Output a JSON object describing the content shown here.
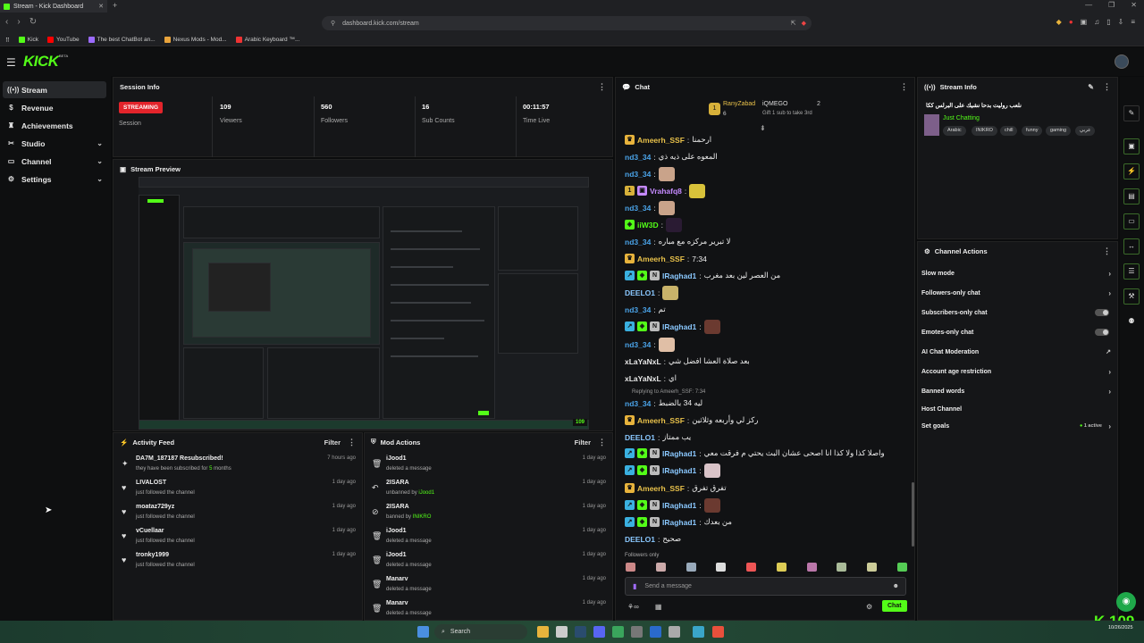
{
  "browser": {
    "tab_title": "Stream - Kick Dashboard",
    "url": "dashboard.kick.com/stream",
    "bookmarks": [
      {
        "label": "Kick",
        "color": "#53fc18"
      },
      {
        "label": "YouTube",
        "color": "#ff0000"
      },
      {
        "label": "The best ChatBot an...",
        "color": "#9c6bff"
      },
      {
        "label": "Nexus Mods - Mod...",
        "color": "#e8a33c"
      },
      {
        "label": "Arabic Keyboard ™...",
        "color": "#e33"
      }
    ]
  },
  "app": {
    "logo": "KICK",
    "logo_badge": "BETA"
  },
  "sidebar": {
    "items": [
      {
        "label": "Stream",
        "icon": "broadcast-icon",
        "active": true
      },
      {
        "label": "Revenue",
        "icon": "dollar-icon"
      },
      {
        "label": "Achievements",
        "icon": "trophy-icon"
      },
      {
        "label": "Studio",
        "icon": "studio-icon",
        "chevron": true
      },
      {
        "label": "Channel",
        "icon": "channel-icon",
        "chevron": true
      },
      {
        "label": "Settings",
        "icon": "gear-icon",
        "chevron": true
      }
    ]
  },
  "session_info": {
    "title": "Session Info",
    "badge": "STREAMING",
    "session_label": "Session",
    "stats": [
      {
        "value": "109",
        "label": "Viewers"
      },
      {
        "value": "560",
        "label": "Followers"
      },
      {
        "value": "16",
        "label": "Sub Counts"
      },
      {
        "value": "00:11:57",
        "label": "Time Live"
      }
    ]
  },
  "stream_preview": {
    "title": "Stream Preview",
    "viewer_badge": "109"
  },
  "activity_feed": {
    "title": "Activity Feed",
    "filter": "Filter",
    "items": [
      {
        "name": "DA7M_187187 Resubscribed!",
        "sub_prefix": "they have been subscribed for ",
        "sub_highlight": "5",
        "sub_suffix": " months",
        "time": "7 hours ago",
        "icon": "star-icon"
      },
      {
        "name": "LIVALOST",
        "sub_prefix": "just followed the channel",
        "sub_highlight": "",
        "sub_suffix": "",
        "time": "1 day ago",
        "icon": "heart-icon"
      },
      {
        "name": "moataz729yz",
        "sub_prefix": "just followed the channel",
        "sub_highlight": "",
        "sub_suffix": "",
        "time": "1 day ago",
        "icon": "heart-icon"
      },
      {
        "name": "vCuellaar",
        "sub_prefix": "just followed the channel",
        "sub_highlight": "",
        "sub_suffix": "",
        "time": "1 day ago",
        "icon": "heart-icon"
      },
      {
        "name": "tronky1999",
        "sub_prefix": "just followed the channel",
        "sub_highlight": "",
        "sub_suffix": "",
        "time": "1 day ago",
        "icon": "heart-icon"
      }
    ]
  },
  "mod_actions": {
    "title": "Mod Actions",
    "filter": "Filter",
    "items": [
      {
        "name": "iJood1",
        "sub_prefix": "deleted a message",
        "sub_highlight": "",
        "time": "1 day ago",
        "icon": "trash-icon"
      },
      {
        "name": "2ISARA",
        "sub_prefix": "unbanned by ",
        "sub_highlight": "iJood1",
        "time": "1 day ago",
        "icon": "undo-icon"
      },
      {
        "name": "2ISARA",
        "sub_prefix": "banned by ",
        "sub_highlight": "INIKRO",
        "time": "1 day ago",
        "icon": "ban-icon"
      },
      {
        "name": "iJood1",
        "sub_prefix": "deleted a message",
        "sub_highlight": "",
        "time": "1 day ago",
        "icon": "trash-icon"
      },
      {
        "name": "iJood1",
        "sub_prefix": "deleted a message",
        "sub_highlight": "",
        "time": "1 day ago",
        "icon": "trash-icon"
      },
      {
        "name": "Manarv",
        "sub_prefix": "deleted a message",
        "sub_highlight": "",
        "time": "1 day ago",
        "icon": "trash-icon"
      },
      {
        "name": "Manarv",
        "sub_prefix": "deleted a message",
        "sub_highlight": "",
        "time": "1 day ago",
        "icon": "trash-icon"
      }
    ]
  },
  "chat": {
    "title": "Chat",
    "pinned": {
      "leader1_name": "RanyZabad",
      "leader1_score": "6",
      "leader2_name": "iQMEGO",
      "leader2_score": "2",
      "gift_note": "Gift 1 sub to take 3rd"
    },
    "messages": [
      {
        "user": "Ameerh_SSF",
        "color": "#e8c14a",
        "badges": [
          "crown"
        ],
        "text": "ارحمنا"
      },
      {
        "user": "nd3_34",
        "color": "#4aa3e8",
        "badges": [],
        "text": "المعوه على ذيه ذي"
      },
      {
        "user": "nd3_34",
        "color": "#4aa3e8",
        "badges": [],
        "text": "",
        "emote": "#c9a38a"
      },
      {
        "user": "Vrahafq8",
        "color": "#c58aff",
        "badges": [
          "gold",
          "gift"
        ],
        "text": "",
        "emote": "#d8c23a"
      },
      {
        "user": "nd3_34",
        "color": "#4aa3e8",
        "badges": [],
        "text": "",
        "emote": "#c9a38a"
      },
      {
        "user": "iiW3D",
        "color": "#53fc18",
        "badges": [
          "vip"
        ],
        "text": "",
        "emote": "#2a1b33"
      },
      {
        "user": "nd3_34",
        "color": "#4aa3e8",
        "badges": [],
        "text": "لا تبرير مركزه مع مباره"
      },
      {
        "user": "Ameerh_SSF",
        "color": "#e8c14a",
        "badges": [
          "crown"
        ],
        "text": "7:34"
      },
      {
        "user": "lRaghad1",
        "color": "#8ac8ff",
        "badges": [
          "mod",
          "vip",
          "sub"
        ],
        "text": "من العصر لين بعد مغرب"
      },
      {
        "user": "DEELO1",
        "color": "#8ac8ff",
        "badges": [],
        "text": "",
        "emote": "#c9b36a"
      },
      {
        "user": "nd3_34",
        "color": "#4aa3e8",
        "badges": [],
        "text": "تم"
      },
      {
        "user": "lRaghad1",
        "color": "#8ac8ff",
        "badges": [
          "mod",
          "vip",
          "sub"
        ],
        "text": "",
        "emote": "#6b3a30"
      },
      {
        "user": "nd3_34",
        "color": "#4aa3e8",
        "badges": [],
        "text": "",
        "emote": "#e0bfa6"
      },
      {
        "user": "xLaYaNxL",
        "color": "#e8e8e8",
        "badges": [],
        "text": "بعد صلاة العشا افضل شي"
      },
      {
        "user": "xLaYaNxL",
        "color": "#e8e8e8",
        "badges": [],
        "text": "اي"
      },
      {
        "user": "nd3_34",
        "color": "#4aa3e8",
        "badges": [],
        "text": "ليه 34 بالضبط"
      },
      {
        "user": "Ameerh_SSF",
        "color": "#e8c14a",
        "badges": [
          "crown"
        ],
        "text": "ركز لي وأربعه وثلاثين"
      },
      {
        "user": "DEELO1",
        "color": "#8ac8ff",
        "badges": [],
        "text": "يب ممتاز"
      },
      {
        "user": "lRaghad1",
        "color": "#8ac8ff",
        "badges": [
          "mod",
          "vip",
          "sub"
        ],
        "text": "واصلا كذا ولا كذا انا اصحى عشان البث يحتي م فرقت معي"
      },
      {
        "user": "lRaghad1",
        "color": "#8ac8ff",
        "badges": [
          "mod",
          "vip",
          "sub"
        ],
        "text": "",
        "emote": "#d9c3c8"
      },
      {
        "user": "Ameerh_SSF",
        "color": "#e8c14a",
        "badges": [
          "crown"
        ],
        "text": "تفرق تفرق"
      },
      {
        "user": "lRaghad1",
        "color": "#8ac8ff",
        "badges": [
          "mod",
          "vip",
          "sub"
        ],
        "text": "",
        "emote": "#6b3a30"
      },
      {
        "user": "lRaghad1",
        "color": "#8ac8ff",
        "badges": [
          "mod",
          "vip",
          "sub"
        ],
        "text": "من بعدك"
      },
      {
        "user": "DEELO1",
        "color": "#8ac8ff",
        "badges": [],
        "text": "صحيح"
      }
    ],
    "reply_note": "Replying to Ameerh_SSF: 7:34",
    "followers_only": "Followers only",
    "input_placeholder": "Send a message",
    "send_label": "Chat",
    "emote_colors": [
      "#c88",
      "#caa",
      "#9ab",
      "#ddd",
      "#e55",
      "#dc5",
      "#b7a",
      "#ab9",
      "#cc9",
      "#5c5"
    ]
  },
  "stream_info": {
    "title": "Stream Info",
    "stream_title": "نلعب روليت بدحا نشيك على البرلس ككا",
    "category": "Just Chatting",
    "tags": [
      "Arabic",
      "INIKRO",
      "chill",
      "funny",
      "gaming",
      "عربي"
    ]
  },
  "channel_actions": {
    "title": "Channel Actions",
    "rows": [
      {
        "label": "Slow mode",
        "control": "chevron"
      },
      {
        "label": "Followers-only chat",
        "control": "chevron"
      },
      {
        "label": "Subscribers-only chat",
        "control": "toggle"
      },
      {
        "label": "Emotes-only chat",
        "control": "toggle"
      },
      {
        "label": "AI Chat Moderation",
        "control": "chart"
      },
      {
        "label": "Account age restriction",
        "control": "chevron"
      },
      {
        "label": "Banned words",
        "control": "chevron"
      },
      {
        "label": "Host Channel",
        "control": "none"
      },
      {
        "label": "Set goals",
        "control": "chevron",
        "extra": "1 active"
      }
    ]
  },
  "viewer_count_corner": "109",
  "taskbar": {
    "search": "Search",
    "time": "10/26/2025"
  }
}
